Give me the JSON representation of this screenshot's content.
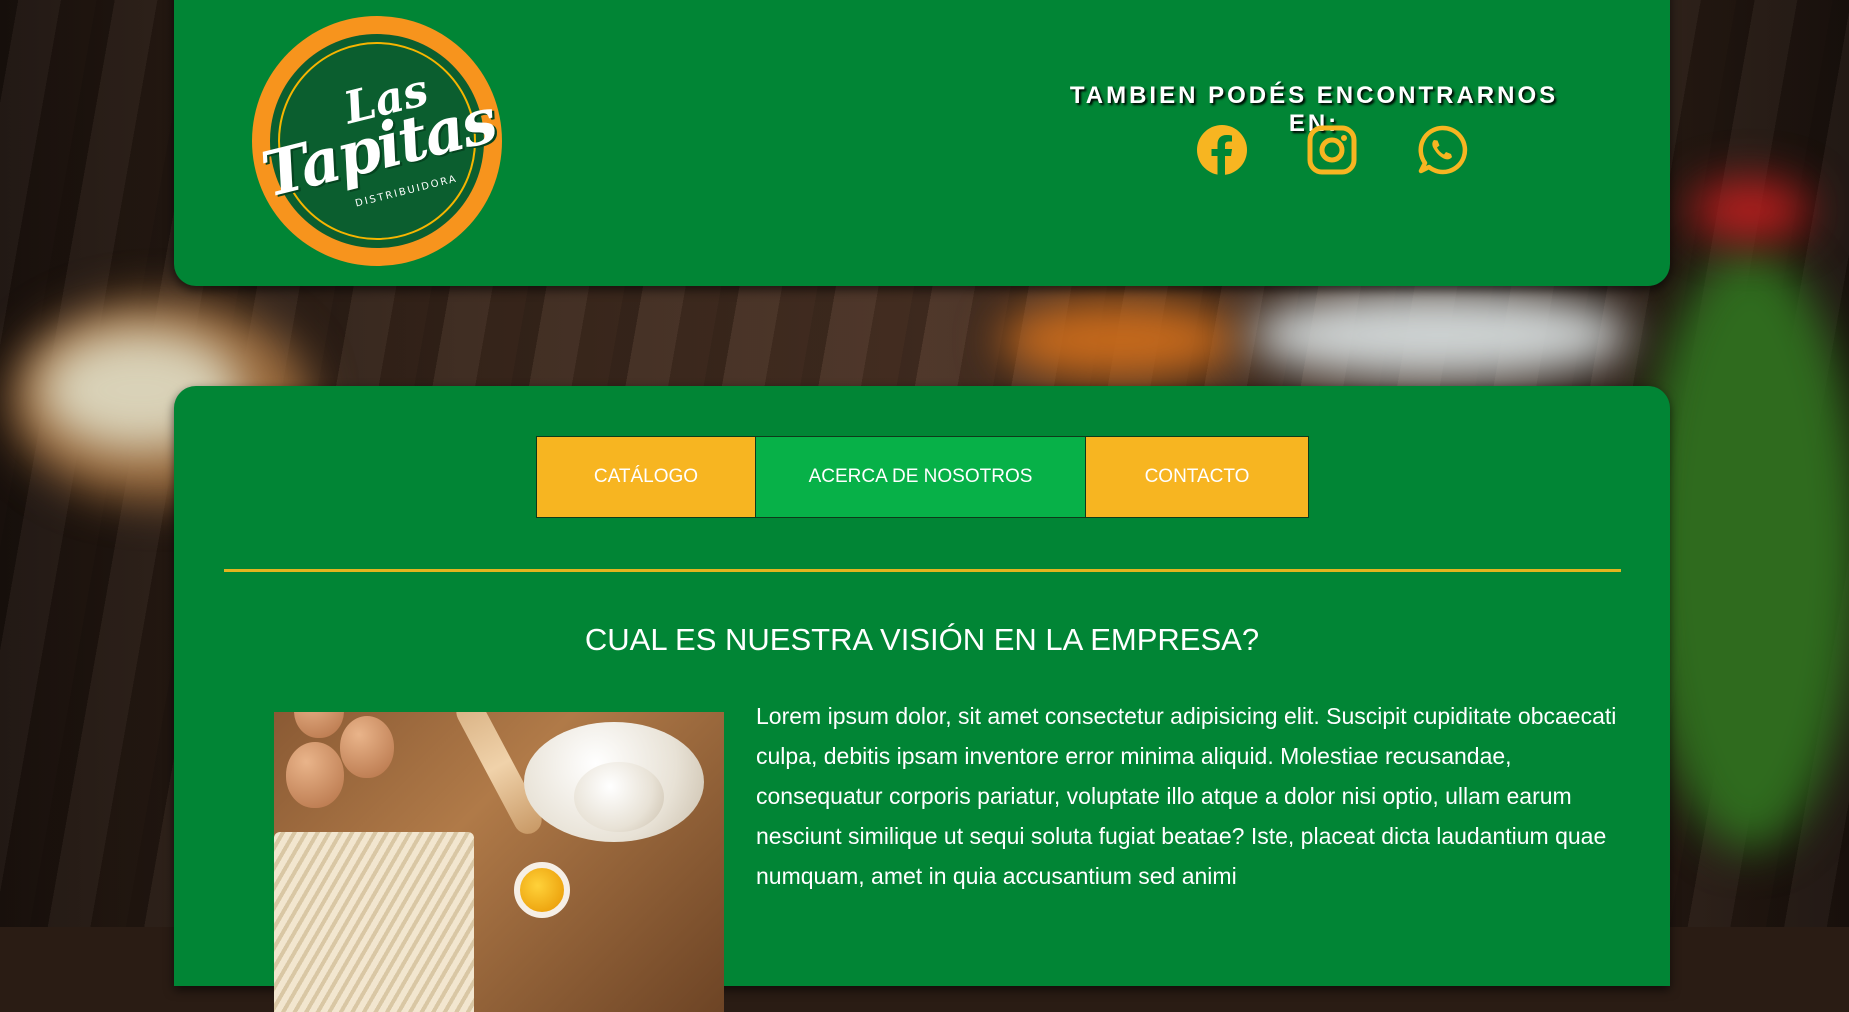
{
  "header": {
    "logo": {
      "line1": "Las",
      "line2": "Tapitas",
      "line3": "DISTRIBUIDORA"
    },
    "follow_title": "TAMBIEN PODÉS ENCONTRARNOS EN:",
    "social_icons": [
      "facebook-icon",
      "instagram-icon",
      "whatsapp-icon"
    ]
  },
  "nav": {
    "items": [
      {
        "label": "CATÁLOGO"
      },
      {
        "label": "ACERCA DE NOSOTROS"
      },
      {
        "label": "CONTACTO"
      }
    ]
  },
  "main": {
    "heading": "CUAL ES NUESTRA VISIÓN EN LA EMPRESA?",
    "paragraph": "Lorem ipsum dolor, sit amet consectetur adipisicing elit. Suscipit cupiditate obcaecati culpa, debitis ipsam inventore error minima aliquid. Molestiae recusandae, consequatur corporis pariatur, voluptate illo atque a dolor nisi optio, ullam earum nesciunt similique ut sequi soluta fugiat beatae? Iste, placeat dicta laudantium quae numquam, amet in quia accusantium sed animi"
  },
  "colors": {
    "card_green": "#018535",
    "accent_yellow": "#f7b521",
    "active_green": "#07b148",
    "logo_orange": "#f7941d"
  }
}
